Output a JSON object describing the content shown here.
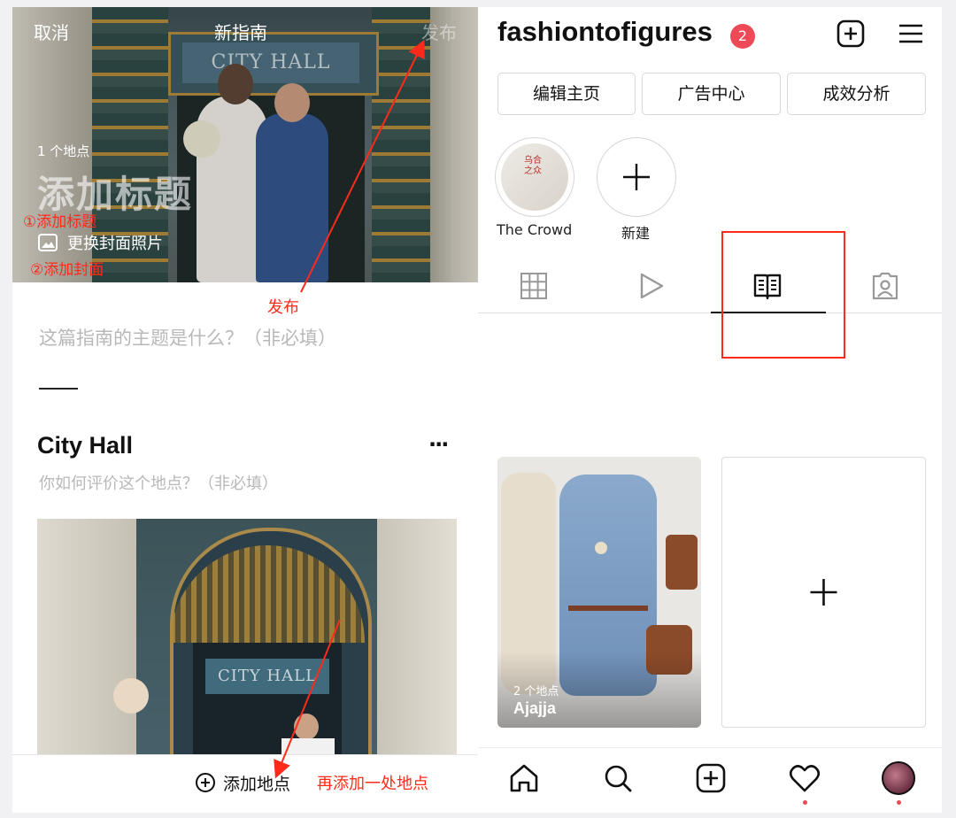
{
  "guide_editor": {
    "cancel": "取消",
    "title": "新指南",
    "publish_btn": "发布",
    "place_count": "1 个地点",
    "title_placeholder": "添加标题",
    "change_cover": "更换封面照片",
    "cover_sign": "CITY HALL",
    "topic_placeholder": "这篇指南的主题是什么？（非必填）",
    "place_name": "City Hall",
    "more": "···",
    "rating_placeholder": "你如何评价这个地点？（非必填）",
    "place_sign": "CITY HALL",
    "add_place": "添加地点"
  },
  "annotations": {
    "add_title": "①添加标题",
    "add_cover": "②添加封面",
    "publish": "发布",
    "add_another": "再添加一处地点"
  },
  "profile": {
    "username": "fashiontofigures",
    "notification_count": "2",
    "buttons": [
      "编辑主页",
      "广告中心",
      "成效分析"
    ],
    "highlights": [
      {
        "label": "The Crowd",
        "cover_text": "乌合\n之众"
      },
      {
        "label": "新建"
      }
    ],
    "guide_card": {
      "count": "2 个地点",
      "name": "Ajajja"
    }
  },
  "colors": {
    "accent_red": "#ff2a1a",
    "badge_red": "#ed4956"
  }
}
